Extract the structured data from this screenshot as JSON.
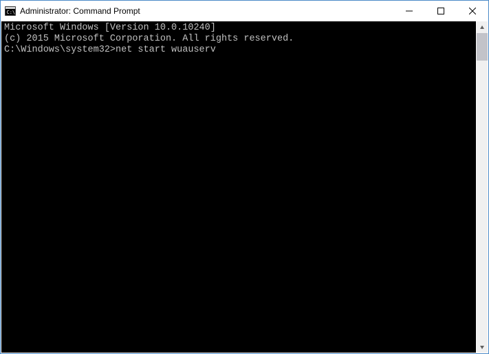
{
  "window": {
    "title": "Administrator: Command Prompt"
  },
  "terminal": {
    "line1": "Microsoft Windows [Version 10.0.10240]",
    "line2": "(c) 2015 Microsoft Corporation. All rights reserved.",
    "blank": "",
    "prompt": "C:\\Windows\\system32>",
    "command": "net start wuauserv"
  }
}
